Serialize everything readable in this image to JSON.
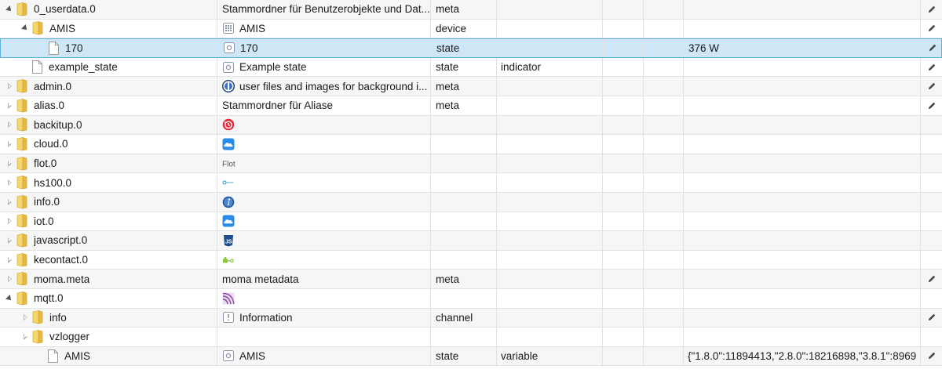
{
  "rows": [
    {
      "id": "0_userdata.0",
      "depth": 0,
      "toggle": "expanded",
      "kind": "folder",
      "name": "Stammordner für Benutzerobjekte und Dat...",
      "name_icon": "none",
      "type": "meta",
      "role": "",
      "value": "",
      "edit": true
    },
    {
      "id": "AMIS",
      "depth": 1,
      "toggle": "expanded",
      "kind": "folder",
      "name": "AMIS",
      "name_icon": "device-icon",
      "type": "device",
      "role": "",
      "value": "",
      "edit": true
    },
    {
      "id": "170",
      "depth": 2,
      "toggle": "none",
      "kind": "file",
      "name": "170",
      "name_icon": "state-icon",
      "type": "state",
      "role": "",
      "value": "376 W",
      "edit": true,
      "selected": true
    },
    {
      "id": "example_state",
      "depth": 1,
      "toggle": "none",
      "kind": "file",
      "name": "Example state",
      "name_icon": "state-icon",
      "type": "state",
      "role": "indicator",
      "value": "",
      "edit": true
    },
    {
      "id": "admin.0",
      "depth": 0,
      "toggle": "collapsed",
      "kind": "folder",
      "name": "user files and images for background i...",
      "name_icon": "admin-icon",
      "type": "meta",
      "role": "",
      "value": "",
      "edit": true
    },
    {
      "id": "alias.0",
      "depth": 0,
      "toggle": "collapsed",
      "kind": "folder",
      "name": "Stammordner für Aliase",
      "name_icon": "none",
      "type": "meta",
      "role": "",
      "value": "",
      "edit": true
    },
    {
      "id": "backitup.0",
      "depth": 0,
      "toggle": "collapsed",
      "kind": "folder",
      "name": "",
      "name_icon": "backitup-icon",
      "type": "",
      "role": "",
      "value": "",
      "edit": false
    },
    {
      "id": "cloud.0",
      "depth": 0,
      "toggle": "collapsed",
      "kind": "folder",
      "name": "",
      "name_icon": "cloud-icon",
      "type": "",
      "role": "",
      "value": "",
      "edit": false
    },
    {
      "id": "flot.0",
      "depth": 0,
      "toggle": "collapsed",
      "kind": "folder",
      "name": "",
      "name_icon": "flot-icon",
      "icon_text": "Flot",
      "type": "",
      "role": "",
      "value": "",
      "edit": false
    },
    {
      "id": "hs100.0",
      "depth": 0,
      "toggle": "collapsed",
      "kind": "folder",
      "name": "",
      "name_icon": "tplink-icon",
      "type": "",
      "role": "",
      "value": "",
      "edit": false
    },
    {
      "id": "info.0",
      "depth": 0,
      "toggle": "collapsed",
      "kind": "folder",
      "name": "",
      "name_icon": "info-icon",
      "type": "",
      "role": "",
      "value": "",
      "edit": false
    },
    {
      "id": "iot.0",
      "depth": 0,
      "toggle": "collapsed",
      "kind": "folder",
      "name": "",
      "name_icon": "cloud-icon",
      "type": "",
      "role": "",
      "value": "",
      "edit": false
    },
    {
      "id": "javascript.0",
      "depth": 0,
      "toggle": "collapsed",
      "kind": "folder",
      "name": "",
      "name_icon": "javascript-icon",
      "type": "",
      "role": "",
      "value": "",
      "edit": false
    },
    {
      "id": "kecontact.0",
      "depth": 0,
      "toggle": "collapsed",
      "kind": "folder",
      "name": "",
      "name_icon": "kecontact-icon",
      "type": "",
      "role": "",
      "value": "",
      "edit": false
    },
    {
      "id": "moma.meta",
      "depth": 0,
      "toggle": "collapsed",
      "kind": "folder",
      "name": "moma metadata",
      "name_icon": "none",
      "type": "meta",
      "role": "",
      "value": "",
      "edit": true
    },
    {
      "id": "mqtt.0",
      "depth": 0,
      "toggle": "expanded",
      "kind": "folder",
      "name": "",
      "name_icon": "mqtt-icon",
      "type": "",
      "role": "",
      "value": "",
      "edit": false
    },
    {
      "id": "info",
      "depth": 1,
      "toggle": "collapsed",
      "kind": "folder",
      "name": "Information",
      "name_icon": "channel-icon",
      "type": "channel",
      "role": "",
      "value": "",
      "edit": true
    },
    {
      "id": "vzlogger",
      "depth": 1,
      "toggle": "collapsed",
      "kind": "folder",
      "name": "",
      "name_icon": "none",
      "type": "",
      "role": "",
      "value": "",
      "edit": false
    },
    {
      "id": "AMIS",
      "depth": 2,
      "toggle": "none",
      "kind": "file",
      "name": "AMIS",
      "name_icon": "state-icon",
      "type": "state",
      "role": "variable",
      "value": "{\"1.8.0\":11894413,\"2.8.0\":18216898,\"3.8.1\":8969",
      "edit": true
    }
  ],
  "colors": {
    "selected_bg": "#cfe6f6",
    "selected_border": "#5aaee0",
    "folder": "#f2c84b"
  }
}
